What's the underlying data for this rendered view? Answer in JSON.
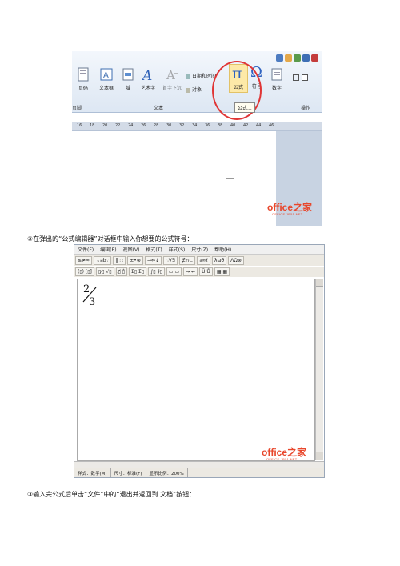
{
  "shot1": {
    "ribbon_buttons": [
      {
        "label": "页码",
        "icon": "page-number-icon"
      },
      {
        "label": "文本框",
        "icon": "textbox-icon"
      },
      {
        "label": "域",
        "icon": "field-icon"
      },
      {
        "label": "艺术字",
        "icon": "wordart-icon"
      },
      {
        "label": "首字下沉",
        "icon": "dropcap-icon"
      },
      {
        "label": "公式",
        "icon": "pi-icon"
      },
      {
        "label": "符号",
        "icon": "omega-icon"
      },
      {
        "label": "数字",
        "icon": "number-icon"
      }
    ],
    "small_buttons": [
      "日期和时间",
      "对象"
    ],
    "group_labels": [
      "页脚",
      "文本",
      "操作"
    ],
    "tooltip": "公式...",
    "ruler_ticks": [
      "16",
      "18",
      "20",
      "22",
      "24",
      "26",
      "28",
      "30",
      "32",
      "34",
      "36",
      "38",
      "40",
      "42",
      "44",
      "46"
    ],
    "watermark": "office之家",
    "watermark_sub": "OFFICE.JB51.NET"
  },
  "caption_1": "②在弹出的“公式编辑器”对话框中输入你想要的公式符号：",
  "shot2": {
    "menu": [
      "文件(F)",
      "编辑(E)",
      "视图(V)",
      "格式(T)",
      "样式(S)",
      "尺寸(Z)",
      "帮助(H)"
    ],
    "toolbar_row1": [
      "≤≠≈",
      "↓ab∵",
      "‖ ⫶ ⫶",
      "±•⊗",
      "→⇔↓",
      "∴∀∃",
      "∉∩⊂",
      "∂∞ℓ",
      "λωθ",
      "ΛΩ⊗"
    ],
    "toolbar_row2": [
      "(▯) [▯]",
      "▯⁄▯ √▯",
      "▯̸ ▯̂",
      "Σ▯ Σ▯",
      "∫▯ ∮▯",
      "▭ ▭",
      "→ ←",
      "Ũ Ů",
      "▦ ▦"
    ],
    "formula_numerator": "2",
    "formula_denominator": "3",
    "status": [
      "样式：数学(M)",
      "尺寸：标准(F)",
      "显示比例：200%"
    ],
    "watermark": "office之家",
    "watermark_sub": "OFFICE.JB51.NET"
  },
  "caption_2": "③输入完公式后单击“文件”中的“退出并返回到 文档”按钮："
}
